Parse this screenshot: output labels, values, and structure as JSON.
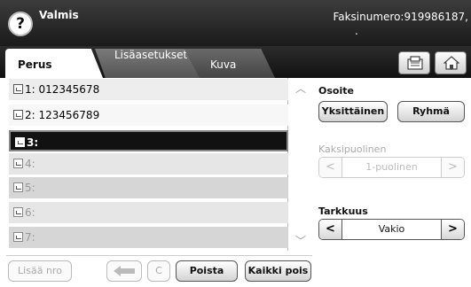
{
  "header": {
    "status": "Valmis",
    "fax_number": "Faksinumero:919986187,",
    "fax_number_tail": ".",
    "help_label": "?"
  },
  "tabs": [
    {
      "label": "Perus",
      "active": true
    },
    {
      "label": "Lisäasetukset",
      "active": false
    },
    {
      "label": "Kuva",
      "active": false
    }
  ],
  "icons": {
    "job": "job-status-icon",
    "home": "home-icon"
  },
  "list": {
    "items": [
      {
        "label": "1: 012345678",
        "state": "normal"
      },
      {
        "label": "2: 123456789",
        "state": "normal"
      },
      {
        "label": "3:",
        "state": "selected"
      },
      {
        "label": "4:",
        "state": "disabled"
      },
      {
        "label": "5:",
        "state": "disabled"
      },
      {
        "label": "6:",
        "state": "disabled"
      },
      {
        "label": "7:",
        "state": "disabled"
      }
    ]
  },
  "bottom": {
    "add_number": "Lisää nro",
    "clear": "C",
    "delete": "Poista",
    "delete_all": "Kaikki pois"
  },
  "address": {
    "title": "Osoite",
    "individual": "Yksittäinen",
    "group": "Ryhmä"
  },
  "duplex": {
    "title": "Kaksipuolinen",
    "value": "1-puolinen"
  },
  "resolution": {
    "title": "Tarkkuus",
    "value": "Vakio"
  }
}
